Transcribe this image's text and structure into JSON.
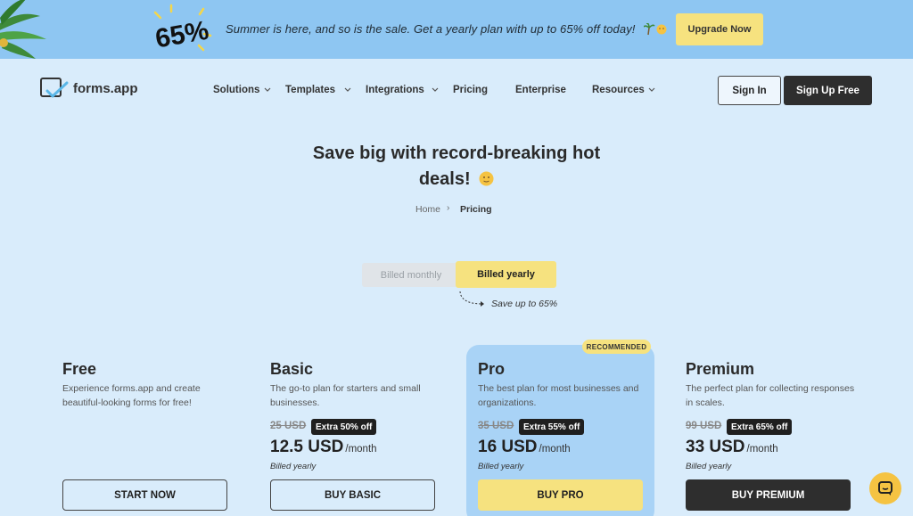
{
  "banner": {
    "badge_text": "65%",
    "message": "Summer is here, and so is the sale. Get a yearly plan with up to 65% off today!",
    "upgrade_label": "Upgrade Now"
  },
  "header": {
    "logo_text": "forms.app",
    "nav": [
      {
        "label": "Solutions",
        "dropdown": true
      },
      {
        "label": "Templates",
        "dropdown": true
      },
      {
        "label": "Integrations",
        "dropdown": true
      },
      {
        "label": "Pricing",
        "dropdown": false
      },
      {
        "label": "Enterprise",
        "dropdown": false
      },
      {
        "label": "Resources",
        "dropdown": true
      }
    ],
    "sign_in_label": "Sign In",
    "sign_up_label": "Sign Up Free"
  },
  "hero": {
    "title_line1": "Save big with record-breaking hot",
    "title_line2": "deals!",
    "breadcrumb": {
      "home": "Home",
      "separator": "›",
      "current": "Pricing"
    }
  },
  "billing": {
    "monthly_label": "Billed monthly",
    "yearly_label": "Billed yearly",
    "selected": "yearly",
    "save_note": "Save up to 65%"
  },
  "plans": [
    {
      "name": "Free",
      "description": "Experience forms.app and create beautiful-looking forms for free!",
      "old_price": "",
      "discount": "",
      "price": "",
      "per": "",
      "billed": "",
      "button": "START NOW",
      "recommended": false
    },
    {
      "name": "Basic",
      "description": "The go-to plan for starters and small businesses.",
      "old_price": "25 USD",
      "discount": "Extra 50% off",
      "price": "12.5 USD",
      "per": "/month",
      "billed": "Billed yearly",
      "button": "BUY BASIC",
      "recommended": false
    },
    {
      "name": "Pro",
      "description": "The best plan for most businesses and organizations.",
      "old_price": "35 USD",
      "discount": "Extra 55% off",
      "price": "16 USD",
      "per": "/month",
      "billed": "Billed yearly",
      "button": "BUY PRO",
      "recommended": true,
      "recommended_label": "RECOMMENDED"
    },
    {
      "name": "Premium",
      "description": "The perfect plan for collecting responses in scales.",
      "old_price": "99 USD",
      "discount": "Extra 65% off",
      "price": "33 USD",
      "per": "/month",
      "billed": "Billed yearly",
      "button": "BUY PREMIUM",
      "recommended": false
    }
  ],
  "colors": {
    "page_bg": "#d9ecfb",
    "banner_bg": "#8ec6f2",
    "accent_yellow": "#f6e27f",
    "dark": "#2e2e2e",
    "pro_card_bg": "#a9d3f6"
  },
  "icons": {
    "palm": "palm-leaves-icon",
    "sun": "sun-emoji-icon",
    "chat": "chat-bubble-icon"
  }
}
